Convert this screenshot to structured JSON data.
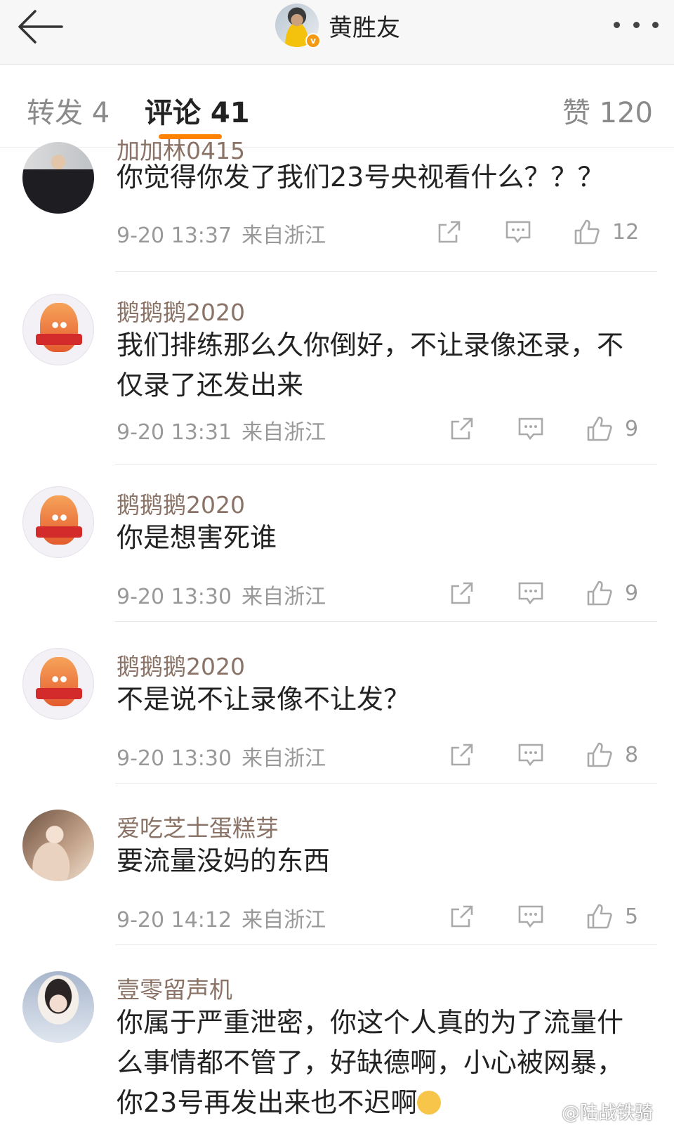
{
  "header": {
    "back_icon": "arrow-left-icon",
    "user_name": "黄胜友",
    "verified_badge": "v",
    "more_icon": "more-dots-icon"
  },
  "tabs": {
    "repost": "转发 4",
    "comment": "评论 41",
    "like": "赞 120"
  },
  "comments": [
    {
      "user": "加加林0415",
      "text": "你觉得你发了我们23号央视看什么？？？",
      "time": "9-20 13:37",
      "location": "来自浙江",
      "likes": "12"
    },
    {
      "user": "鹅鹅鹅2020",
      "text": "我们排练那么久你倒好，不让录像还录，不仅录了还发出来",
      "time": "9-20 13:31",
      "location": "来自浙江",
      "likes": "9"
    },
    {
      "user": "鹅鹅鹅2020",
      "text": "你是想害死谁",
      "time": "9-20 13:30",
      "location": "来自浙江",
      "likes": "9"
    },
    {
      "user": "鹅鹅鹅2020",
      "text": "不是说不让录像不让发？",
      "time": "9-20 13:30",
      "location": "来自浙江",
      "likes": "8"
    },
    {
      "user": "爱吃芝士蛋糕芽",
      "text": "要流量没妈的东西",
      "time": "9-20 14:12",
      "location": "来自浙江",
      "likes": "5"
    },
    {
      "user": "壹零留声机",
      "text": "你属于严重泄密，你这个人真的为了流量什么事情都不管了，好缺德啊，小心被网暴，你23号再发出来也不迟啊",
      "emoji": "crying-emoji"
    }
  ],
  "watermark": "@陆战铁骑",
  "colors": {
    "accent": "#ff8200",
    "username": "#8a7366",
    "meta": "#999999"
  }
}
